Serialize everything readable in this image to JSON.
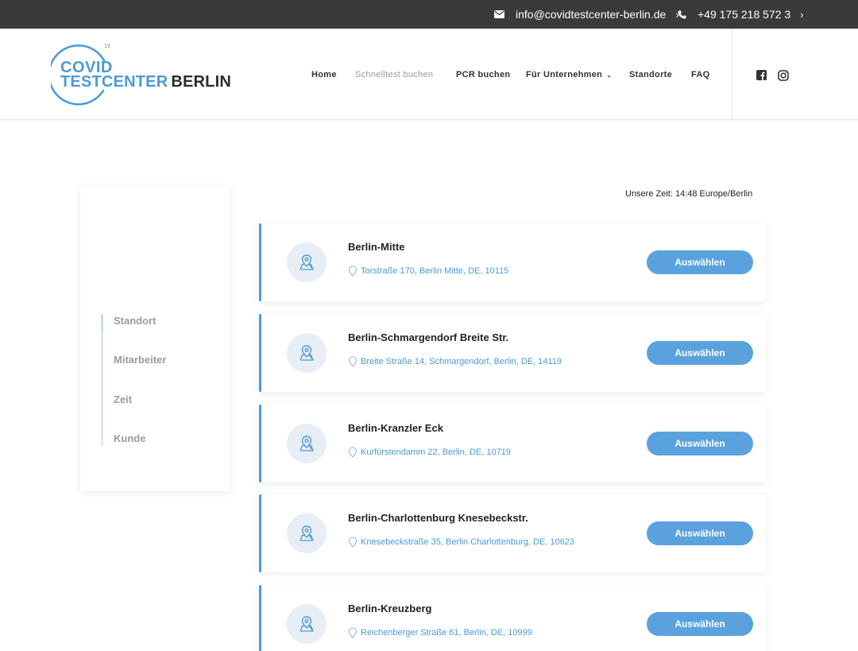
{
  "topbar": {
    "email": "info@covidtestcenter-berlin.de",
    "phone": "+49 175 218 572 3",
    "chevron": "›"
  },
  "logo": {
    "line1": "COVID",
    "line2_a": "TESTCENTER",
    "line2_b": "BERLIN",
    "superscript": "19"
  },
  "nav": {
    "home": "Home",
    "schnelltest": "Schnelltest buchen",
    "pcr": "PCR buchen",
    "unternehmen": "Für Unternehmen",
    "standorte": "Standorte",
    "faq": "FAQ",
    "caret": "⌄"
  },
  "sidebar": {
    "steps": [
      "Standort",
      "Mitarbeiter",
      "Zeit",
      "Kunde"
    ]
  },
  "main": {
    "time_text": "Unsere Zeit: 14:48 Europe/Berlin",
    "button_label": "Auswählen",
    "locations": [
      {
        "name": "Berlin-Mitte",
        "address": "Torstraße 170, Berlin Mitte, DE, 10115"
      },
      {
        "name": "Berlin-Schmargendorf Breite Str.",
        "address": "Breite Straße 14, Schmargendorf, Berlin, DE, 14119"
      },
      {
        "name": "Berlin-Kranzler Eck",
        "address": "Kurfürstendamm 22, Berlin, DE, 10719"
      },
      {
        "name": "Berlin-Charlottenburg Knesebeckstr.",
        "address": "Knesebeckstraße 35, Berlin Charlottenburg, DE, 10623"
      },
      {
        "name": "Berlin-Kreuzberg",
        "address": "Reichenberger Straße 61, Berlin, DE, 10999"
      }
    ]
  },
  "colors": {
    "accent": "#4a9ad8",
    "button": "#5aa2de",
    "topbar": "#3a3a3a"
  },
  "icons": {
    "email": "envelope-icon",
    "phone": "phone-icon",
    "facebook": "facebook-icon",
    "instagram": "instagram-icon",
    "location": "map-pin-icon"
  }
}
